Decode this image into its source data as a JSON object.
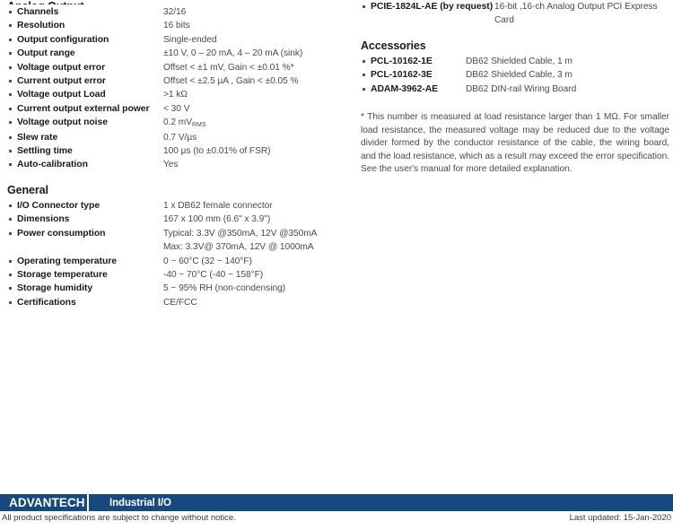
{
  "document": {
    "left_column": {
      "sections": [
        {
          "heading": "Analog Output",
          "heading_clipped": true,
          "rows": [
            {
              "label": "Channels",
              "value": "32/16"
            },
            {
              "label": "Resolution",
              "value": "16 bits"
            },
            {
              "label": "Output configuration",
              "value": "Single-ended"
            },
            {
              "label": "Output range",
              "value": "±10 V, 0 – 20 mA, 4 – 20 mA (sink)"
            },
            {
              "label": "Voltage output error",
              "value": "Offset < ±1 mV, Gain < ±0.01 %*"
            },
            {
              "label": "Current output error",
              "value": "Offset < ±2.5 µA , Gain < ±0.05 %"
            },
            {
              "label": "Voltage output Load",
              "value": ">1 kΩ"
            },
            {
              "label": "Current output external power",
              "value": "< 30 V"
            },
            {
              "label": "Voltage output noise",
              "value": "0.2 mV",
              "value_sub": "RMS"
            },
            {
              "label": "Slew rate",
              "value": "0.7 V/µs"
            },
            {
              "label": "Settling time",
              "value": "100 µs (to ±0.01% of FSR)"
            },
            {
              "label": "Auto-calibration",
              "value": "Yes"
            }
          ]
        },
        {
          "heading": "General",
          "heading_clipped": false,
          "rows": [
            {
              "label": "I/O Connector type",
              "value": "1 x DB62 female connector"
            },
            {
              "label": "Dimensions",
              "value": "167 x 100 mm (6.6\" x 3.9\")"
            },
            {
              "label": "Power consumption",
              "value": "Typical: 3.3V @350mA, 12V @350mA",
              "value_line2": "Max: 3.3V@ 370mA, 12V @ 1000mA"
            },
            {
              "label": "Operating temperature",
              "value": "0 ~ 60°C (32 ~ 140°F)"
            },
            {
              "label": "Storage temperature",
              "value": "-40 ~ 70°C (-40 ~ 158°F)"
            },
            {
              "label": "Storage humidity",
              "value": "5 ~ 95% RH (non-condensing)"
            },
            {
              "label": "Certifications",
              "value": "CE/FCC"
            }
          ]
        }
      ]
    },
    "right_column": {
      "ordering_row": {
        "label": "PCIE-1824L-AE (by request)",
        "value": "16-bit ,16-ch Analog Output PCI Express Card"
      },
      "accessories": {
        "heading": "Accessories",
        "rows": [
          {
            "label": "PCL-10162-1E",
            "value": "DB62 Shielded Cable, 1 m"
          },
          {
            "label": "PCL-10162-3E",
            "value": "DB62 Shielded Cable, 3 m"
          },
          {
            "label": "ADAM-3962-AE",
            "value": "DB62 DIN-rail Wiring Board"
          }
        ]
      },
      "footnote": "* This number is measured at load resistance larger than 1 MΩ. For smaller load resistance, the measured voltage may be reduced due to the voltage divider formed by the conductor resistance of the cable, the wiring board, and the load resistance, which as a result may exceed the error specification. See the user's manual for more detailed explanation."
    },
    "footer": {
      "brand": "ADVANTECH",
      "section": "Industrial I/O",
      "disclaimer": "All product specifications are subject to change without notice.",
      "last_updated": "Last updated: 15-Jan-2020",
      "bar_color": "#17497f"
    }
  }
}
